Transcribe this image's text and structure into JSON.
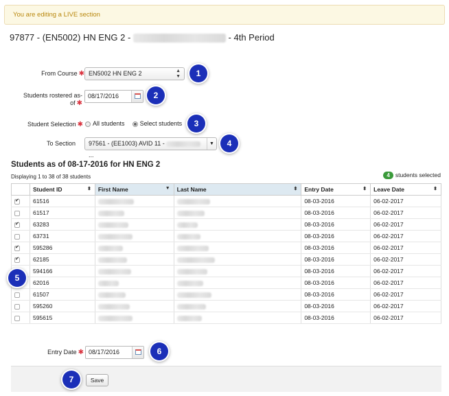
{
  "banner": "You are editing a LIVE section",
  "title": {
    "prefix": "97877 - (EN5002) HN ENG 2 - ",
    "suffix": "- 4th Period"
  },
  "form": {
    "from_course_label": "From Course",
    "from_course_value": "EN5002 HN ENG 2",
    "rostered_label_1": "Students rostered as-",
    "rostered_label_2": "of",
    "rostered_date": "08/17/2016",
    "selection_label": "Student Selection",
    "option_all": "All students",
    "option_select": "Select students",
    "to_section_label": "To Section",
    "to_section_value": "97561 - (EE1003) AVID 11 -",
    "entry_date_label": "Entry Date",
    "entry_date_value": "08/17/2016",
    "save_label": "Save"
  },
  "students": {
    "heading": "Students as of 08-17-2016 for HN ENG 2",
    "displaying": "Displaying 1 to 38 of 38 students",
    "selected_count": "4",
    "selected_suffix": "students selected",
    "columns": [
      "Student ID",
      "First Name",
      "Last Name",
      "Entry Date",
      "Leave Date"
    ],
    "rows": [
      {
        "checked": true,
        "id": "61516",
        "entry": "08-03-2016",
        "leave": "06-02-2017"
      },
      {
        "checked": false,
        "id": "61517",
        "entry": "08-03-2016",
        "leave": "06-02-2017"
      },
      {
        "checked": true,
        "id": "63283",
        "entry": "08-03-2016",
        "leave": "06-02-2017"
      },
      {
        "checked": false,
        "id": "63731",
        "entry": "08-03-2016",
        "leave": "06-02-2017"
      },
      {
        "checked": true,
        "id": "595286",
        "entry": "08-03-2016",
        "leave": "06-02-2017"
      },
      {
        "checked": true,
        "id": "62185",
        "entry": "08-03-2016",
        "leave": "06-02-2017"
      },
      {
        "checked": false,
        "id": "594166",
        "entry": "08-03-2016",
        "leave": "06-02-2017"
      },
      {
        "checked": false,
        "id": "62016",
        "entry": "08-03-2016",
        "leave": "06-02-2017"
      },
      {
        "checked": false,
        "id": "61507",
        "entry": "08-03-2016",
        "leave": "06-02-2017"
      },
      {
        "checked": false,
        "id": "595260",
        "entry": "08-03-2016",
        "leave": "06-02-2017"
      },
      {
        "checked": false,
        "id": "595615",
        "entry": "08-03-2016",
        "leave": "06-02-2017"
      }
    ]
  },
  "callouts": [
    "1",
    "2",
    "3",
    "4",
    "5",
    "6",
    "7"
  ],
  "colors": {
    "callout": "#1b2fb8",
    "required": "#d9333f",
    "badge": "#3a9a3a"
  }
}
